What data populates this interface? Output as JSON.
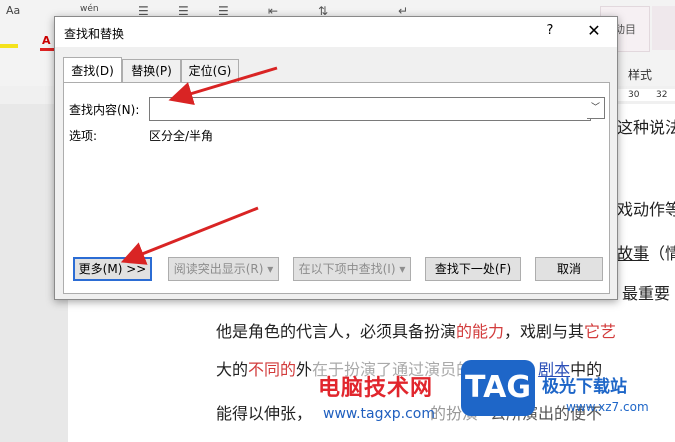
{
  "background": {
    "ribbon_items": [
      "Aa",
      "wén",
      "A"
    ],
    "style_preview": "动目",
    "styles_label": "样式",
    "ruler_numbers": [
      "30",
      "32"
    ],
    "doc_lines": {
      "l1_tail": "这种说法",
      "l2_tail": "戏动作等",
      "l3_tail_link": "故事",
      "l3_tail": "（情",
      "l4_tail": "最重要",
      "l5": {
        "a": "他是角色的代言人，必须具备扮演",
        "b": "的能力",
        "c": "，戏剧与其",
        "d": "它艺"
      },
      "l6": {
        "a": "大的",
        "b": "不同的",
        "c": "外",
        "d": "在于扮演了",
        "e": "通过演员的扮演，",
        "f": "剧本",
        "g": "中的"
      },
      "l7": {
        "a": "能得以伸张，",
        "b": "的扮演",
        "c": "公所演出的便不"
      }
    },
    "watermark": {
      "cn": "电脑技术网",
      "url": "www.tagxp.com",
      "tag": "TAG",
      "site": "极光下载站",
      "site2": "www.xz7.com"
    }
  },
  "dialog": {
    "title": "查找和替换",
    "help": "?",
    "close": "✕",
    "tabs": [
      {
        "label": "查找(D)",
        "active": true
      },
      {
        "label": "替换(P)",
        "active": false
      },
      {
        "label": "定位(G)",
        "active": false
      }
    ],
    "find": {
      "label": "查找内容(N):",
      "value": ""
    },
    "options": {
      "label": "选项:",
      "value": "区分全/半角"
    },
    "buttons": {
      "more": "更多(M) >>",
      "reading_highlight": "阅读突出显示(R) ▾",
      "find_in": "在以下项中查找(I) ▾",
      "find_next": "查找下一处(F)",
      "cancel": "取消"
    }
  },
  "colors": {
    "accent_arrow": "#d92424",
    "focus": "#2b6cd4"
  }
}
